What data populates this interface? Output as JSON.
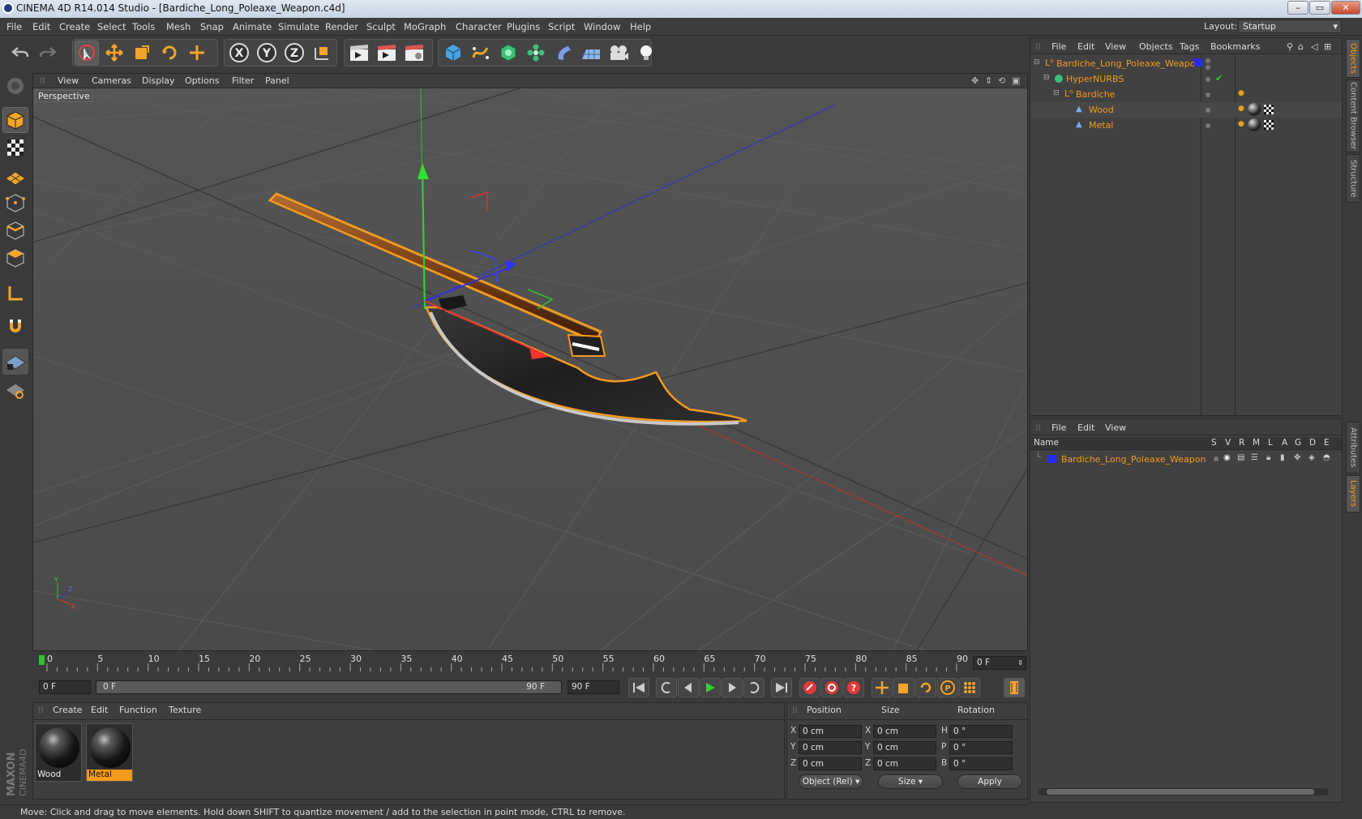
{
  "window": {
    "title": "CINEMA 4D R14.014 Studio - [Bardiche_Long_Poleaxe_Weapon.c4d]",
    "buttons": [
      "–",
      "▭",
      "✕"
    ]
  },
  "menubar": {
    "items": [
      "File",
      "Edit",
      "Create",
      "Select",
      "Tools",
      "Mesh",
      "Snap",
      "Animate",
      "Simulate",
      "Render",
      "Sculpt",
      "MoGraph",
      "Character",
      "Plugins",
      "Script",
      "Window",
      "Help"
    ],
    "layout_label": "Layout:",
    "layout_value": "Startup"
  },
  "toolbar": {
    "axis_buttons": [
      "X",
      "Y",
      "Z"
    ]
  },
  "viewport": {
    "menu": [
      "View",
      "Cameras",
      "Display",
      "Options",
      "Filter",
      "Panel"
    ],
    "label": "Perspective",
    "axis_labels": [
      "Y",
      "Z",
      "X"
    ]
  },
  "timeline": {
    "ticks": [
      "0",
      "5",
      "10",
      "15",
      "20",
      "25",
      "30",
      "35",
      "40",
      "45",
      "50",
      "55",
      "60",
      "65",
      "70",
      "75",
      "80",
      "85",
      "90"
    ],
    "current_frame": "0 F"
  },
  "anim": {
    "start_frame": "0 F",
    "range_start": "0 F",
    "range_end": "90 F",
    "end_frame": "90 F"
  },
  "materials": {
    "menu": [
      "Create",
      "Edit",
      "Function",
      "Texture"
    ],
    "items": [
      {
        "name": "Wood",
        "selected": false
      },
      {
        "name": "Metal",
        "selected": true
      }
    ]
  },
  "coordinates": {
    "headers": [
      "Position",
      "Size",
      "Rotation"
    ],
    "rows": [
      {
        "axis": "X",
        "pos": "0 cm",
        "size_axis": "X",
        "size": "0 cm",
        "rot_axis": "H",
        "rot": "0 °"
      },
      {
        "axis": "Y",
        "pos": "0 cm",
        "size_axis": "Y",
        "size": "0 cm",
        "rot_axis": "P",
        "rot": "0 °"
      },
      {
        "axis": "Z",
        "pos": "0 cm",
        "size_axis": "Z",
        "size": "0 cm",
        "rot_axis": "B",
        "rot": "0 °"
      }
    ],
    "mode": "Object (Rel)",
    "size_mode": "Size",
    "apply": "Apply"
  },
  "objects_panel": {
    "menu": [
      "File",
      "Edit",
      "View",
      "Objects",
      "Tags",
      "Bookmarks"
    ],
    "tree": [
      {
        "name": "Bardiche_Long_Poleaxe_Weapon",
        "icon": "null-icon"
      },
      {
        "name": "HyperNURBS",
        "icon": "hypernurbs-icon"
      },
      {
        "name": "Bardiche",
        "icon": "null-icon"
      },
      {
        "name": "Wood",
        "icon": "polygon-icon"
      },
      {
        "name": "Metal",
        "icon": "polygon-icon"
      }
    ]
  },
  "layers_panel": {
    "menu": [
      "File",
      "Edit",
      "View"
    ],
    "columns": [
      "Name",
      "S",
      "V",
      "R",
      "M",
      "L",
      "A",
      "G",
      "D",
      "E"
    ],
    "layers": [
      {
        "name": "Bardiche_Long_Poleaxe_Weapon",
        "color": "#2a2aff"
      }
    ]
  },
  "right_tabs": [
    "Objects",
    "Content Browser",
    "Structure",
    "Attributes",
    "Layers"
  ],
  "status": "Move: Click and drag to move elements. Hold down SHIFT to quantize movement / add to the selection in point mode, CTRL to remove.",
  "colors": {
    "accent": "#f39a1d",
    "selection": "#f49b1a"
  }
}
